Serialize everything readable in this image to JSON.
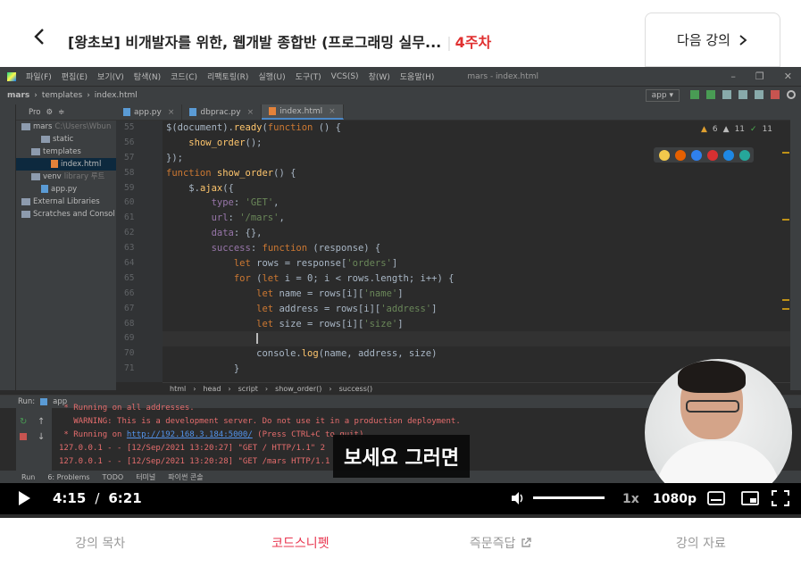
{
  "header": {
    "course_title": "[왕초보] 비개발자를 위한, 웹개발 종합반 (프로그래밍 실무...",
    "week": "4주차",
    "next_lesson": "다음 강의"
  },
  "ide": {
    "menu": [
      "파일(F)",
      "편집(E)",
      "보기(V)",
      "탐색(N)",
      "코드(C)",
      "리팩토링(R)",
      "실행(U)",
      "도구(T)",
      "VCS(S)",
      "창(W)",
      "도움말(H)"
    ],
    "window_title": "mars - index.html",
    "breadcrumb": [
      "mars",
      "templates",
      "index.html"
    ],
    "run_config": "app",
    "project_header": "Pro",
    "project_tree": [
      {
        "label": "mars",
        "extra": "C:\\Users\\Wbun",
        "kind": "folder",
        "indent": 0
      },
      {
        "label": "static",
        "extra": "",
        "kind": "folder",
        "indent": 2
      },
      {
        "label": "templates",
        "extra": "",
        "kind": "folder",
        "indent": 1
      },
      {
        "label": "index.html",
        "extra": "",
        "kind": "html",
        "indent": 3
      },
      {
        "label": "venv",
        "extra": "library 루트",
        "kind": "folder",
        "indent": 1
      },
      {
        "label": "app.py",
        "extra": "",
        "kind": "py",
        "indent": 2
      },
      {
        "label": "External Libraries",
        "extra": "",
        "kind": "folder",
        "indent": 0
      },
      {
        "label": "Scratches and Consol",
        "extra": "",
        "kind": "folder",
        "indent": 0
      }
    ],
    "tabs": [
      {
        "label": "app.py",
        "kind": "py",
        "active": false
      },
      {
        "label": "dbprac.py",
        "kind": "py",
        "active": false
      },
      {
        "label": "index.html",
        "kind": "html",
        "active": true
      }
    ],
    "inspections": {
      "warnings": "6",
      "weak": "11",
      "ok": "11"
    },
    "line_numbers": [
      "55",
      "56",
      "57",
      "58",
      "59",
      "60",
      "61",
      "62",
      "63",
      "64",
      "65",
      "66",
      "67",
      "68",
      "69",
      "70",
      "71"
    ],
    "code_lines": [
      "$(document).ready(function () {",
      "    show_order();",
      "});",
      "function show_order() {",
      "    $.ajax({",
      "        type: 'GET',",
      "        url: '/mars',",
      "        data: {},",
      "        success: function (response) {",
      "            let rows = response['orders']",
      "            for (let i = 0; i < rows.length; i++) {",
      "                let name = rows[i]['name']",
      "                let address = rows[i]['address']",
      "                let size = rows[i]['size']",
      "                ",
      "                console.log(name, address, size)",
      "            }"
    ],
    "editor_crumb": [
      "html",
      "head",
      "script",
      "show_order()",
      "success()"
    ],
    "run_label": "Run:",
    "run_tab": "app",
    "run_output": [
      " * Running on all addresses.",
      "   WARNING: This is a development server. Do not use it in a production deployment.",
      " * Running on ",
      "127.0.0.1 - - [12/Sep/2021 13:20:27] \"GET / HTTP/1.1\" 2",
      "127.0.0.1 - - [12/Sep/2021 13:20:28] \"GET /mars HTTP/1.1"
    ],
    "run_link": "http://192.168.3.184:5000/",
    "run_link_suffix": " (Press CTRL+C to quit)",
    "bottom_tools": [
      "Run",
      "6: Problems",
      "TODO",
      "터미널",
      "파이썬 콘솔"
    ]
  },
  "subtitle": "보세요 그러면",
  "player": {
    "current_time": "4:15",
    "separator": "/",
    "duration": "6:21",
    "played_fraction": 0.67,
    "loaded_fraction": 0.85,
    "speed": "1x",
    "quality": "1080p"
  },
  "bottom_nav": [
    {
      "label": "강의 목차",
      "active": false
    },
    {
      "label": "코드스니펫",
      "active": true
    },
    {
      "label": "즉문즉답",
      "active": false
    },
    {
      "label": "강의 자료",
      "active": false
    }
  ],
  "colors": {
    "accent": "#e8344e",
    "week": "#e03030"
  }
}
